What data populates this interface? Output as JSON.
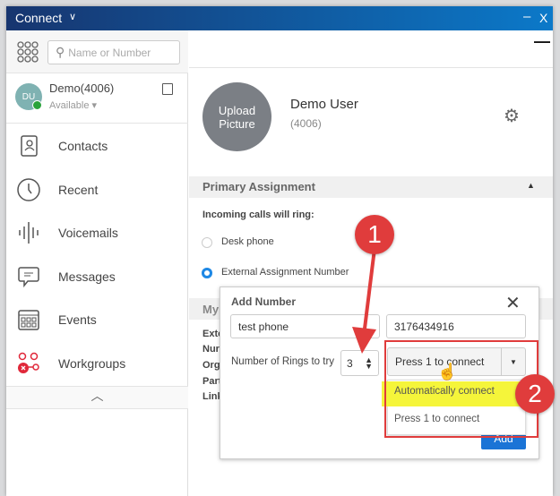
{
  "titlebar": {
    "title": "Connect",
    "minimize": "–",
    "close": "X"
  },
  "sidebar": {
    "search_placeholder": "Name or Number",
    "user": {
      "initials": "DU",
      "name": "Demo(4006)",
      "status": "Available ▾"
    },
    "items": [
      {
        "label": "Contacts",
        "icon": "contacts-icon"
      },
      {
        "label": "Recent",
        "icon": "clock-icon"
      },
      {
        "label": "Voicemails",
        "icon": "voicemail-icon"
      },
      {
        "label": "Messages",
        "icon": "message-icon"
      },
      {
        "label": "Events",
        "icon": "calendar-icon"
      },
      {
        "label": "Workgroups",
        "icon": "workgroups-icon"
      }
    ]
  },
  "main": {
    "minimize": "—",
    "upload_picture": "Upload Picture",
    "name": "Demo User",
    "extension": "(4006)",
    "primary_assignment": "Primary Assignment",
    "incoming_label": "Incoming calls will ring:",
    "radios": [
      {
        "label": "Desk phone",
        "checked": false
      },
      {
        "label": "External Assignment Number",
        "checked": true
      }
    ],
    "my_section": "My",
    "my_labels": [
      "Exte",
      "Nur",
      "Org",
      "Part",
      "Link"
    ]
  },
  "dialog": {
    "title": "Add Number",
    "name_value": "test phone",
    "number_value": "3176434916",
    "rings_label": "Number of Rings to try",
    "rings_value": "3",
    "select_value": "Press 1 to connect",
    "options": [
      "Automatically connect",
      "Press 1 to connect"
    ],
    "add_button": "Add"
  },
  "annotations": {
    "badge1": "1",
    "badge2": "2",
    "accent": "#e03c3c",
    "highlight": "#f5f53a"
  },
  "colors": {
    "brand": "#0b79c9",
    "primary_button": "#1b74d6"
  }
}
